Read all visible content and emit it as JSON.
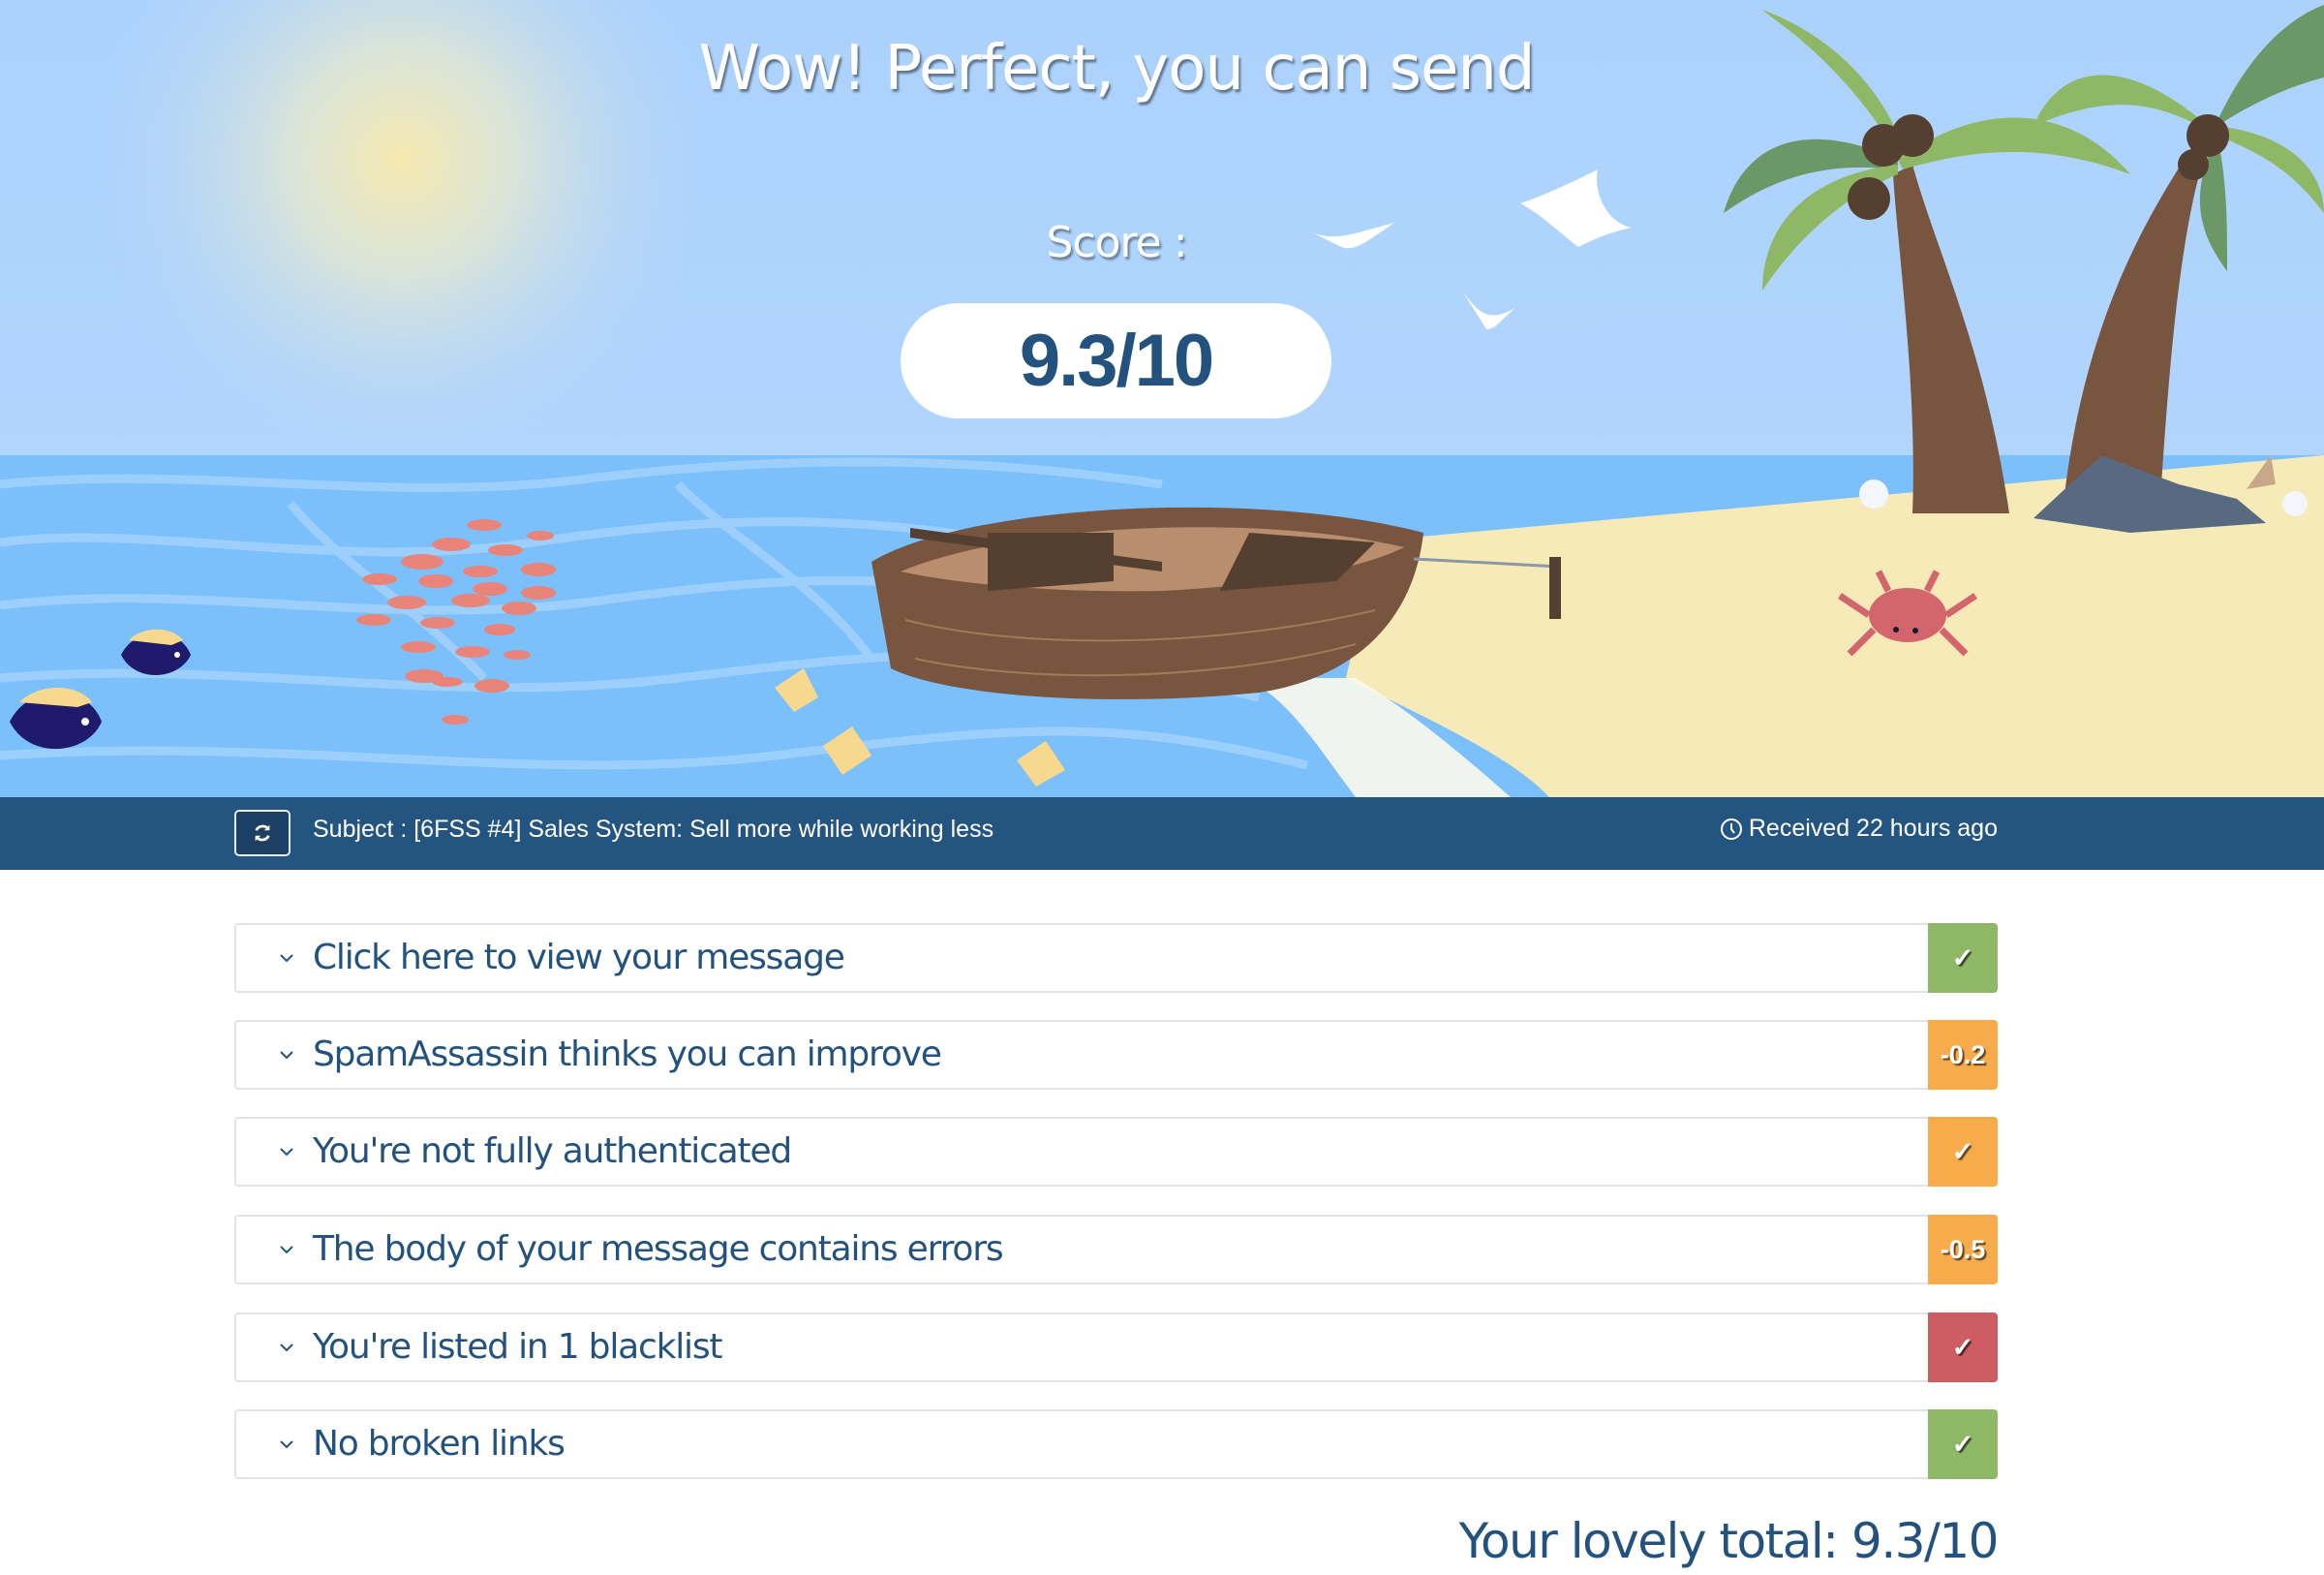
{
  "hero": {
    "title": "Wow! Perfect, you can send",
    "score_label": "Score :",
    "score_value": "9.3/10",
    "score": 9.3,
    "score_max": 10
  },
  "subject_bar": {
    "refresh_icon": "refresh-icon",
    "subject": "Subject : [6FSS #4] Sales System: Sell more while working less",
    "received_icon": "clock-icon",
    "received": "Received 22 hours ago"
  },
  "checks": [
    {
      "label": "Click here to view your message",
      "badge": "✓",
      "status": "pass",
      "color": "#8fb866"
    },
    {
      "label": "SpamAssassin thinks you can improve",
      "badge": "-0.2",
      "status": "warning",
      "color": "#f7ab4a"
    },
    {
      "label": "You're not fully authenticated",
      "badge": "✓",
      "status": "warning",
      "color": "#f7ab4a"
    },
    {
      "label": "The body of your message contains errors",
      "badge": "-0.5",
      "status": "warning",
      "color": "#f7ab4a"
    },
    {
      "label": "You're listed in 1 blacklist",
      "badge": "✓",
      "status": "fail",
      "color": "#cd5c63"
    },
    {
      "label": "No broken links",
      "badge": "✓",
      "status": "pass",
      "color": "#8fb866"
    }
  ],
  "total": "Your lovely total: 9.3/10",
  "colors": {
    "brand": "#245580",
    "text": "#24527e",
    "pass": "#8fb866",
    "warning": "#f7ab4a",
    "fail": "#cd5c63"
  }
}
